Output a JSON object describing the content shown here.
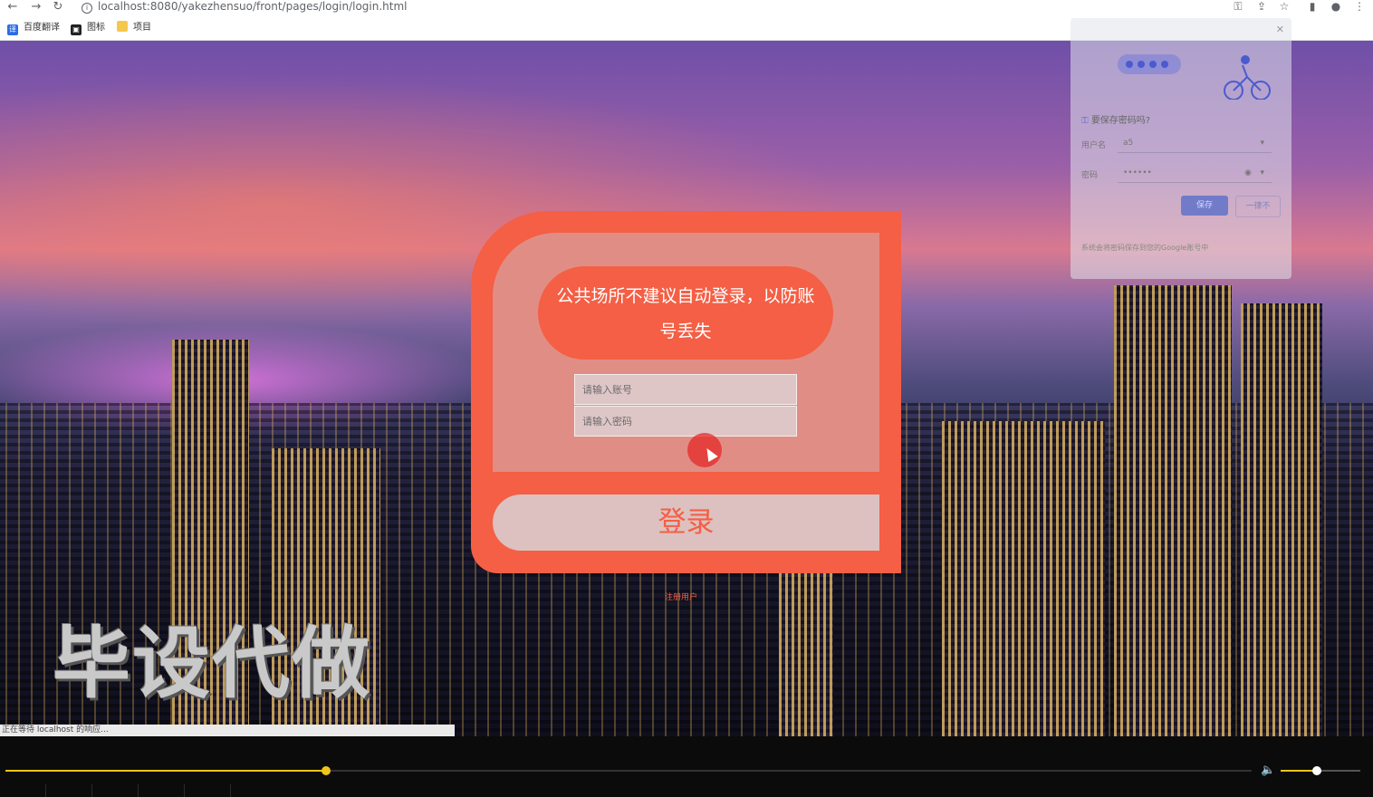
{
  "browser": {
    "url": "localhost:8080/yakezhensuo/front/pages/login/login.html",
    "back_icon": "arrow-left-icon",
    "forward_icon": "arrow-right-icon",
    "reload_icon": "reload-icon",
    "bookmarks": [
      {
        "label": "百度翻译",
        "icon": "translate-icon"
      },
      {
        "label": "图标",
        "icon": "image-icon"
      },
      {
        "label": "项目",
        "icon": "folder-icon"
      }
    ]
  },
  "login": {
    "tip": "公共场所不建议自动登录，以防账号丢失",
    "account_placeholder": "请输入账号",
    "password_placeholder": "请输入密码",
    "login_label": "登录",
    "register_label": "注册用户"
  },
  "watermark": "毕设代做",
  "password_prompt": {
    "title": "要保存密码吗?",
    "username_label": "用户名",
    "username_value": "a5",
    "password_label": "密码",
    "password_value": "••••••",
    "save_label": "保存",
    "never_label": "一律不",
    "footer": "系统会将密码保存到您的Google账号中"
  },
  "status_text": "正在等待 localhost 的响应...",
  "player": {
    "progress_fraction": 0.257,
    "volume_fraction": 0.45,
    "accent_color": "#f0c419"
  },
  "colors": {
    "brand": "#f45f45"
  }
}
